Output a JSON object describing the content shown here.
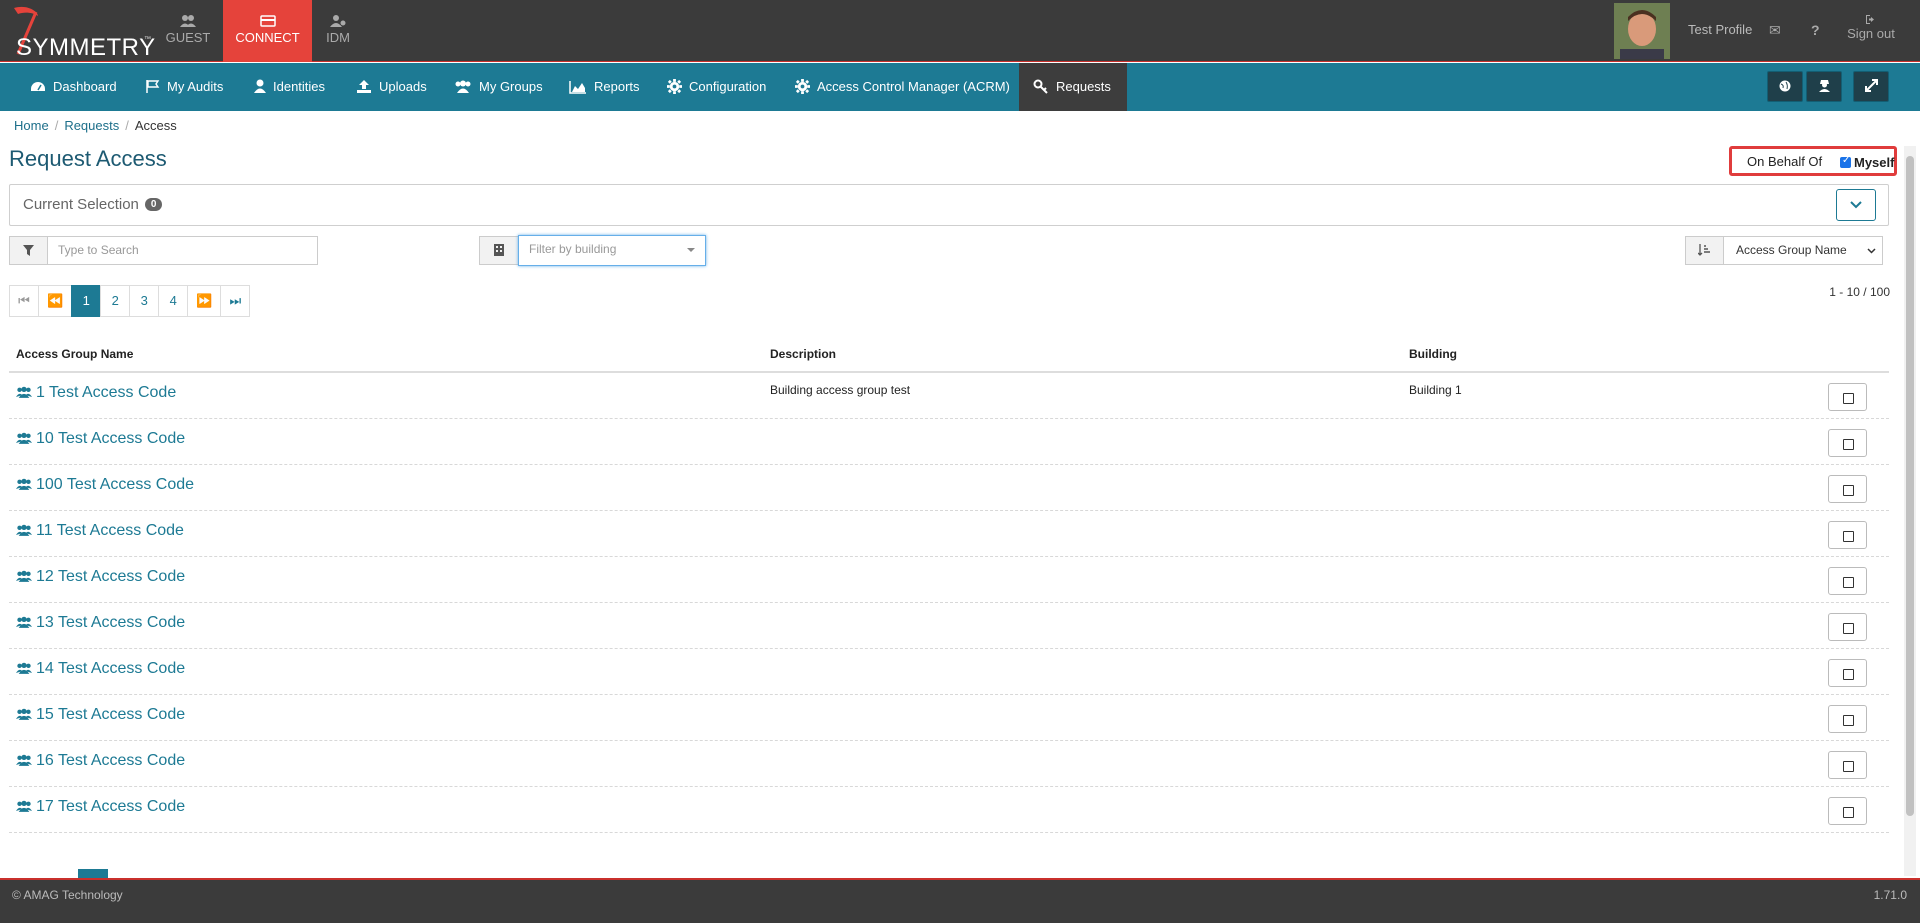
{
  "header": {
    "logo_text": "SYMMETRY",
    "logo_tm": "™",
    "app_tabs": [
      {
        "label": "GUEST",
        "icon": "users-icon"
      },
      {
        "label": "CONNECT",
        "icon": "card-icon"
      },
      {
        "label": "IDM",
        "icon": "user-gear-icon"
      }
    ],
    "profile_name": "Test Profile",
    "signout_label": "Sign out"
  },
  "nav": {
    "items": [
      {
        "label": "Dashboard",
        "icon": "dashboard-icon"
      },
      {
        "label": "My Audits",
        "icon": "flag-icon"
      },
      {
        "label": "Identities",
        "icon": "user-icon"
      },
      {
        "label": "Uploads",
        "icon": "upload-icon"
      },
      {
        "label": "My Groups",
        "icon": "users-icon"
      },
      {
        "label": "Reports",
        "icon": "area-chart-icon"
      },
      {
        "label": "Configuration",
        "icon": "gear-icon"
      },
      {
        "label": "Access Control Manager (ACRM)",
        "icon": "gear-icon"
      },
      {
        "label": "Requests",
        "icon": "key-icon"
      }
    ]
  },
  "breadcrumb": {
    "home": "Home",
    "requests": "Requests",
    "current": "Access"
  },
  "page": {
    "title": "Request Access",
    "on_behalf_label": "On Behalf Of",
    "myself_label": "Myself",
    "current_selection_label": "Current Selection",
    "current_selection_count": "0"
  },
  "filters": {
    "search_placeholder": "Type to Search",
    "building_placeholder": "Filter by building",
    "sort_value": "Access Group Name"
  },
  "pagination": {
    "pages": [
      "1",
      "2",
      "3",
      "4"
    ],
    "active_page": "1",
    "range": "1 - 10 / 100"
  },
  "table": {
    "headers": {
      "name": "Access Group Name",
      "description": "Description",
      "building": "Building"
    },
    "rows": [
      {
        "name": "1 Test Access Code",
        "description": "Building access group test",
        "building": "Building 1"
      },
      {
        "name": "10 Test Access Code",
        "description": "",
        "building": ""
      },
      {
        "name": "100 Test Access Code",
        "description": "",
        "building": ""
      },
      {
        "name": "11 Test Access Code",
        "description": "",
        "building": ""
      },
      {
        "name": "12 Test Access Code",
        "description": "",
        "building": ""
      },
      {
        "name": "13 Test Access Code",
        "description": "",
        "building": ""
      },
      {
        "name": "14 Test Access Code",
        "description": "",
        "building": ""
      },
      {
        "name": "15 Test Access Code",
        "description": "",
        "building": ""
      },
      {
        "name": "16 Test Access Code",
        "description": "",
        "building": ""
      },
      {
        "name": "17 Test Access Code",
        "description": "",
        "building": ""
      }
    ]
  },
  "footer": {
    "copyright": "© AMAG Technology",
    "version": "1.71.0"
  },
  "colors": {
    "brand_red": "#e5433b",
    "nav_teal": "#1d7a94",
    "dark_bar": "#3b3b3b"
  }
}
